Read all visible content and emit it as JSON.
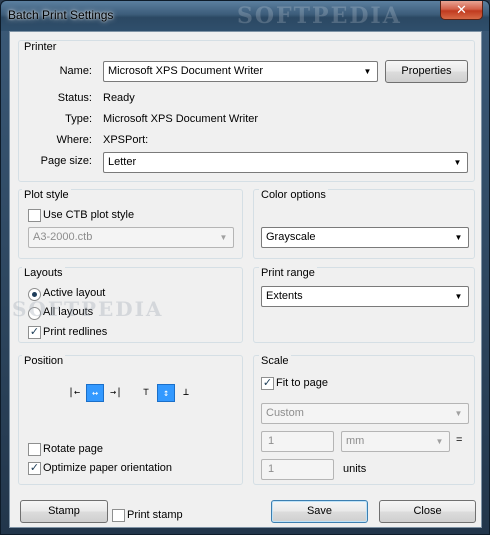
{
  "window": {
    "title": "Batch Print Settings",
    "close_label": "✕",
    "watermark": "SOFTPEDIA"
  },
  "printer": {
    "group_label": "Printer",
    "name_label": "Name:",
    "name_value": "Microsoft XPS Document Writer",
    "properties_button": "Properties",
    "status_label": "Status:",
    "status_value": "Ready",
    "type_label": "Type:",
    "type_value": "Microsoft XPS Document Writer",
    "where_label": "Where:",
    "where_value": "XPSPort:",
    "page_size_label": "Page size:",
    "page_size_value": "Letter"
  },
  "plot_style": {
    "group_label": "Plot style",
    "use_ctb_label": "Use CTB plot style",
    "use_ctb_checked": false,
    "ctb_value": "A3-2000.ctb"
  },
  "color_options": {
    "group_label": "Color options",
    "value": "Grayscale"
  },
  "layouts": {
    "group_label": "Layouts",
    "active_layout_label": "Active layout",
    "all_layouts_label": "All layouts",
    "selected": "Active layout",
    "print_redlines_label": "Print redlines",
    "print_redlines_checked": true
  },
  "print_range": {
    "group_label": "Print range",
    "value": "Extents"
  },
  "position": {
    "group_label": "Position",
    "h_icons": [
      "align-left-icon",
      "align-center-horizontal-icon",
      "align-right-icon"
    ],
    "v_icons": [
      "align-top-icon",
      "align-center-vertical-icon",
      "align-bottom-icon"
    ],
    "h_selected": "align-center-horizontal-icon",
    "v_selected": "align-center-vertical-icon",
    "rotate_label": "Rotate page",
    "rotate_checked": false,
    "optimize_label": "Optimize paper orientation",
    "optimize_checked": true
  },
  "scale": {
    "group_label": "Scale",
    "fit_label": "Fit to page",
    "fit_checked": true,
    "scale_value": "Custom",
    "paper_value": "1",
    "unit_value": "mm",
    "equals": "=",
    "drawing_value": "1",
    "units_label": "units"
  },
  "footer": {
    "stamp_button": "Stamp",
    "print_stamp_label": "Print stamp",
    "print_stamp_checked": false,
    "save_button": "Save",
    "close_button": "Close"
  },
  "colors": {
    "title_bar": "#3c5c7a",
    "close_button": "#c03a1f",
    "selection_blue": "#3399ff",
    "dialog_bg": "#f0f0f0"
  }
}
